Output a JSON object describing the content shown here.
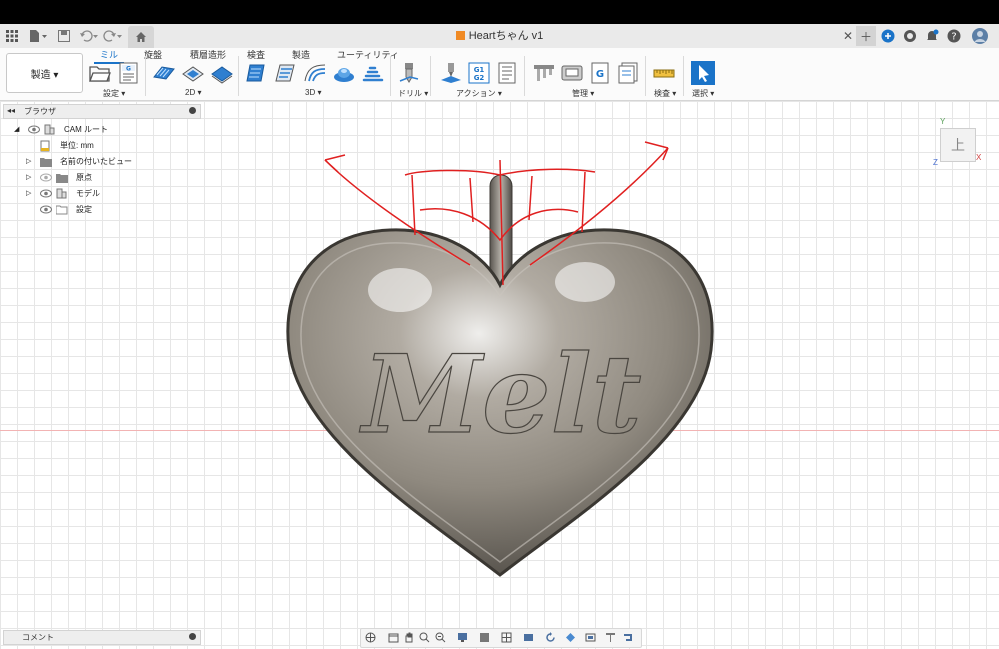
{
  "window": {
    "title": "Heartちゃん v1"
  },
  "workspace": {
    "label": "製造 ▾"
  },
  "tabs": [
    "ミル",
    "旋盤",
    "積層造形",
    "検査",
    "製造",
    "ユーティリティ"
  ],
  "groups": {
    "setup": "設定 ▾",
    "twod": "2D ▾",
    "threed": "3D ▾",
    "drill": "ドリル ▾",
    "action": "アクション ▾",
    "manage": "管理 ▾",
    "inspect": "検査 ▾",
    "select": "選択 ▾"
  },
  "toolbar_icons": {
    "g1g2": "G1\nG2",
    "g": "G"
  },
  "browser": {
    "title": "ブラウザ",
    "items": [
      {
        "label": "CAM ルート"
      },
      {
        "label": "単位: mm"
      },
      {
        "label": "名前の付いたビュー"
      },
      {
        "label": "原点"
      },
      {
        "label": "モデル"
      },
      {
        "label": "設定"
      }
    ]
  },
  "comments": {
    "title": "コメント"
  },
  "viewcube": {
    "face": "上",
    "axes": {
      "y": "Y",
      "x": "X",
      "z": "Z"
    }
  },
  "model": {
    "text": "Melt"
  },
  "colors": {
    "accent": "#1a73c8",
    "annotation": "#e02020",
    "metal": "#9a948a"
  }
}
